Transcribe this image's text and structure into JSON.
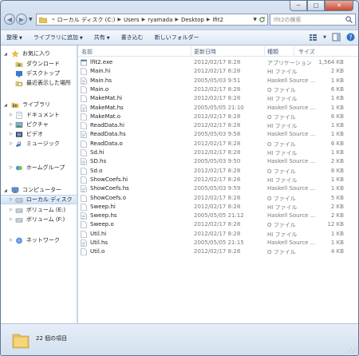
{
  "window": {
    "minimize_glyph": "─",
    "maximize_glyph": "□",
    "close_glyph": "✕"
  },
  "navbar": {
    "back_glyph": "◀",
    "forward_glyph": "▶",
    "breadcrumb_prefix": "«",
    "breadcrumbs": [
      "ローカル ディスク (C:)",
      "Users",
      "ryamada",
      "Desktop",
      "lfit2"
    ],
    "crumb_sep": "▶",
    "search_placeholder": "lfit2の検索"
  },
  "toolbar": {
    "organize": "整理",
    "include_in_library": "ライブラリに追加",
    "share": "共有",
    "burn": "書き込む",
    "new_folder": "新しいフォルダー",
    "dropdown_glyph": "▼"
  },
  "sidebar": {
    "favorites_header": "お気に入り",
    "favorites": [
      "ダウンロード",
      "デスクトップ",
      "最近表示した場所"
    ],
    "libraries_header": "ライブラリ",
    "libraries": [
      "ドキュメント",
      "ピクチャ",
      "ビデオ",
      "ミュージック"
    ],
    "homegroup": "ホームグループ",
    "computer_header": "コンピューター",
    "computer": [
      "ローカル ディスク",
      "ボリューム (E:)",
      "ボリューム (F:)"
    ],
    "network": "ネットワーク"
  },
  "columns": {
    "name": "名前",
    "date": "更新日時",
    "type": "種類",
    "size": "サイズ"
  },
  "files": [
    {
      "name": "lfit2.exe",
      "date": "2012/02/17 8:28",
      "type": "アプリケーション",
      "size": "1,564 KB",
      "kind": "exe"
    },
    {
      "name": "Main.hi",
      "date": "2012/02/17 8:28",
      "type": "HI ファイル",
      "size": "2 KB",
      "kind": "doc"
    },
    {
      "name": "Main.hs",
      "date": "2005/05/03 9:51",
      "type": "Haskell Source ...",
      "size": "1 KB",
      "kind": "hs"
    },
    {
      "name": "Main.o",
      "date": "2012/02/17 8:28",
      "type": "O ファイル",
      "size": "6 KB",
      "kind": "doc"
    },
    {
      "name": "MakeMat.hi",
      "date": "2012/02/17 8:28",
      "type": "HI ファイル",
      "size": "1 KB",
      "kind": "doc"
    },
    {
      "name": "MakeMat.hs",
      "date": "2005/05/05 21:10",
      "type": "Haskell Source ...",
      "size": "1 KB",
      "kind": "hs"
    },
    {
      "name": "MakeMat.o",
      "date": "2012/02/17 8:28",
      "type": "O ファイル",
      "size": "6 KB",
      "kind": "doc"
    },
    {
      "name": "ReadData.hi",
      "date": "2012/02/17 8:28",
      "type": "HI ファイル",
      "size": "1 KB",
      "kind": "doc"
    },
    {
      "name": "ReadData.hs",
      "date": "2005/05/03 9:58",
      "type": "Haskell Source ...",
      "size": "1 KB",
      "kind": "hs"
    },
    {
      "name": "ReadData.o",
      "date": "2012/02/17 8:28",
      "type": "O ファイル",
      "size": "6 KB",
      "kind": "doc"
    },
    {
      "name": "Sd.hi",
      "date": "2012/02/17 8:28",
      "type": "HI ファイル",
      "size": "1 KB",
      "kind": "doc"
    },
    {
      "name": "SD.hs",
      "date": "2005/05/03 9:50",
      "type": "Haskell Source ...",
      "size": "2 KB",
      "kind": "hs"
    },
    {
      "name": "Sd.o",
      "date": "2012/02/17 8:28",
      "type": "O ファイル",
      "size": "8 KB",
      "kind": "doc"
    },
    {
      "name": "ShowCoefs.hi",
      "date": "2012/02/17 8:28",
      "type": "HI ファイル",
      "size": "1 KB",
      "kind": "doc"
    },
    {
      "name": "ShowCoefs.hs",
      "date": "2005/05/03 9:59",
      "type": "Haskell Source ...",
      "size": "1 KB",
      "kind": "hs"
    },
    {
      "name": "ShowCoefs.o",
      "date": "2012/02/17 8:28",
      "type": "O ファイル",
      "size": "5 KB",
      "kind": "doc"
    },
    {
      "name": "Sweep.hi",
      "date": "2012/02/17 8:28",
      "type": "HI ファイル",
      "size": "2 KB",
      "kind": "doc"
    },
    {
      "name": "Sweep.hs",
      "date": "2005/05/05 21:12",
      "type": "Haskell Source ...",
      "size": "2 KB",
      "kind": "hs"
    },
    {
      "name": "Sweep.o",
      "date": "2012/02/17 8:28",
      "type": "O ファイル",
      "size": "12 KB",
      "kind": "doc"
    },
    {
      "name": "Util.hi",
      "date": "2012/02/17 8:28",
      "type": "HI ファイル",
      "size": "1 KB",
      "kind": "doc"
    },
    {
      "name": "Util.hs",
      "date": "2005/05/05 21:15",
      "type": "Haskell Source ...",
      "size": "1 KB",
      "kind": "hs"
    },
    {
      "name": "Util.o",
      "date": "2012/02/17 8:28",
      "type": "O ファイル",
      "size": "4 KB",
      "kind": "doc"
    }
  ],
  "status": {
    "item_count": "22 個の項目"
  },
  "icons": {
    "file_doc": "document-icon",
    "file_hs": "haskell-source-icon",
    "file_exe": "application-icon"
  },
  "colors": {
    "accent": "#2b5797",
    "selection": "#d0e3f7"
  }
}
